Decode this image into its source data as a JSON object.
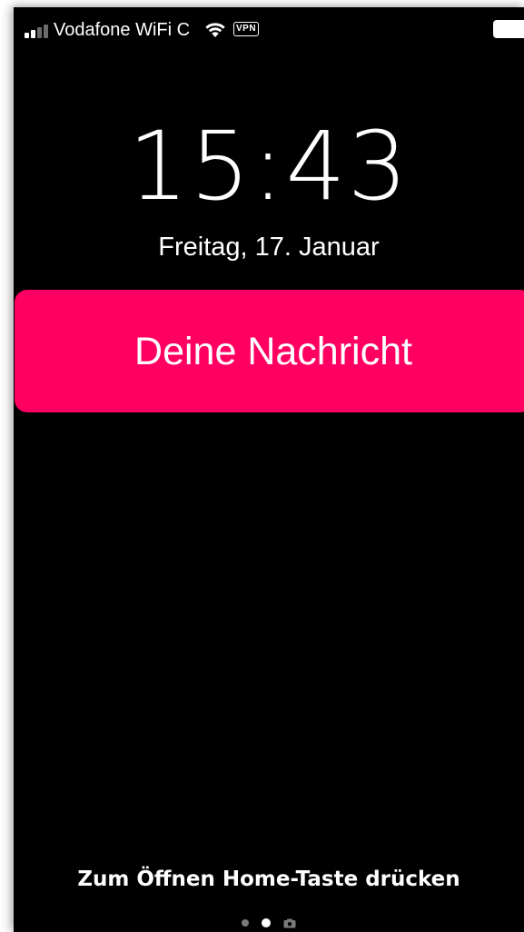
{
  "status_bar": {
    "carrier": "Vodafone WiFi C",
    "vpn": "VPN",
    "signal_bars_filled": 2,
    "signal_bars_total": 4
  },
  "lock_screen": {
    "time": "15:43",
    "date": "Freitag, 17. Januar",
    "notification": {
      "text": "Deine Nachricht",
      "color": "#ff0062"
    },
    "unlock_hint": "Zum Öffnen Home-Taste drücken",
    "page_indicator": {
      "pages": [
        "dot",
        "dot",
        "camera-icon"
      ],
      "active_index": 1
    }
  },
  "colors": {
    "background": "#000000",
    "text": "#ffffff",
    "accent": "#ff0062"
  }
}
